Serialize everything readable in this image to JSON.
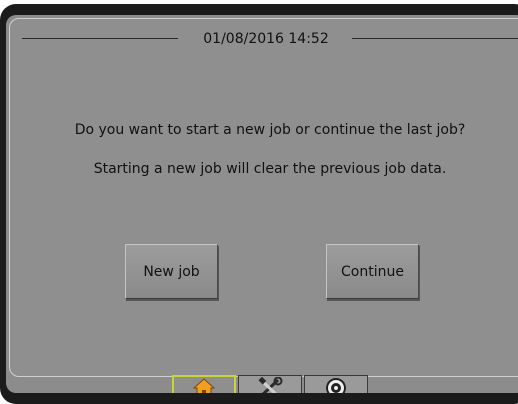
{
  "header": {
    "datetime": "01/08/2016 14:52"
  },
  "dialog": {
    "question": "Do you want to start a new job or continue the last job?",
    "warning": "Starting a new job will clear the previous job data."
  },
  "buttons": {
    "new_job_label": "New job",
    "continue_label": "Continue"
  },
  "tabs": [
    {
      "icon": "home-icon",
      "active": true
    },
    {
      "icon": "tools-icon",
      "active": false
    },
    {
      "icon": "gauge-icon",
      "active": false
    }
  ],
  "colors": {
    "screen_background": "#8f8f8f",
    "active_tab_border": "#c9d33a",
    "home_icon": "#f0a020"
  }
}
